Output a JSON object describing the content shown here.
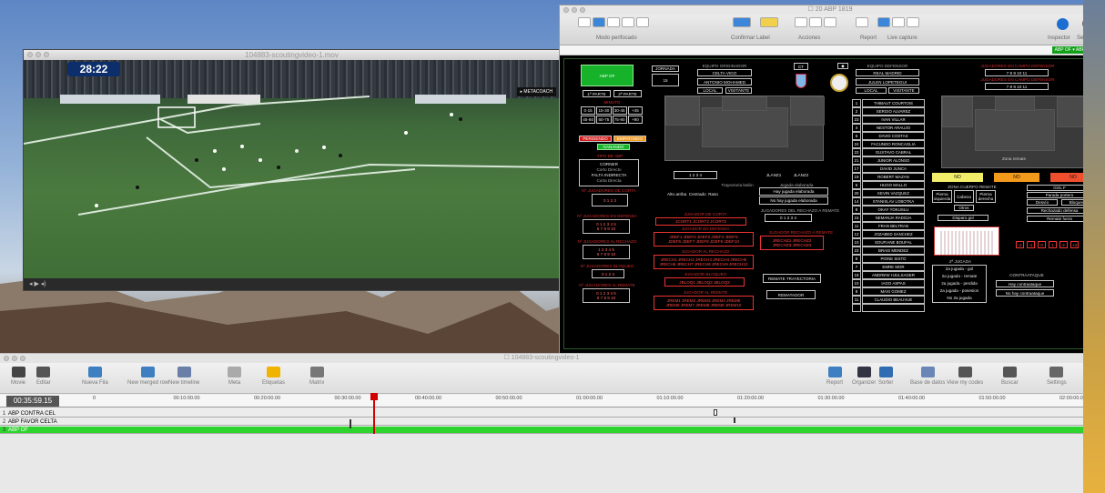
{
  "video": {
    "title": "104883-scoutingvideo-1.mov",
    "clock": "28:22",
    "brand": "▸ METACOACH",
    "control": "◂ ▶ ◂)"
  },
  "panel": {
    "title": "☐ 20 ABP 1819",
    "toolbar": {
      "modo": "Modo perifocado",
      "confirm": "Confirmar  Label",
      "acciones": "Acciones",
      "report": "Report",
      "live": "Live capture",
      "inspector": "Inspector",
      "settings": "Settings"
    },
    "tag": "ABP OF ▾ ABP OF ▴",
    "top_left": {
      "abp_of": "ABP OF",
      "jornada": "JORNADA",
      "jnum": "15",
      "equipo_label": "EQUIPO ORIGINADOR",
      "equipo": "CELTA VIGO",
      "jugador": "ANTONIO MOHAMED",
      "local": "LOCAL",
      "visitante": "VISITANTE",
      "parte1": "1ª PARTE",
      "parte2": "2ª PARTE",
      "minuto": "MINUTO",
      "min": [
        "0-15",
        "15-30",
        "30-45",
        "+45",
        "45-60",
        "60-75",
        "75-90",
        "+90"
      ],
      "ganando": "GANANDO",
      "empatando": "EMPATANDO",
      "perdiendo": "PERDIENDO"
    },
    "tipo": {
      "label": "TIPO DE ABP",
      "corner": "CORNER",
      "corto": "Corto",
      "directo": "Directo",
      "falta": "FALTA INDIRECTA",
      "corta": "Corta",
      "directa": "Directa"
    },
    "zona": {
      "label": "ZONA DE LANZAMIENTO",
      "nums": "1  2  3  4",
      "lanz1": "JLANZ1",
      "lanz2": "JLANZ2",
      "jugada": "Jugada elaborada",
      "hay": "Hay jugada elaborada",
      "no_hay": "No hay jugada elaborada"
    },
    "rechazo": {
      "label": "JUGADORES DEL RECHAZO A REMATE",
      "nums": "0  1  2  3  4"
    },
    "jug_defensa": {
      "label": "JUGADOR EN DEFENSA",
      "rows": [
        "JDEF1 JDEF2 JDEF3 JDEF4 JDEF5",
        "JDEF6 JDEF7 JDEF8 JDEF9 JDEF10"
      ]
    },
    "jug_corta": {
      "label": "JUGADOR DE CORTA",
      "rows": [
        "JCORT1 JCORT2 JCORT3"
      ]
    },
    "remate_rech": {
      "label": "JUGADOR RECHAZO A REMATE",
      "rows": [
        "JRECHZ1 JRECHZ2",
        "JRECHZ3 JRECHZ4"
      ]
    },
    "nums": {
      "corta_l": "Nº JUGADORES DE CORTA",
      "corta": "0 1 2 3",
      "def_l": "Nº JUGADORES EN DEFENSA",
      "def1": "0 1 2 3 4 5",
      "def2": "6 7 8 9 10",
      "rech_l": "Nº JUGADORES AL RECHAZO",
      "rech1": "1 2 3 4 5",
      "rech2": "6 7 8 9 10",
      "bloq_l": "Nº JUGADORES BLOQUEO",
      "bloq": "0 1 2 3",
      "remat_l": "Nº JUGADORES AL REMATE",
      "remat1": "0 1 2 3 4 5",
      "remat2": "6 7 8 9 10"
    },
    "rechaces": {
      "label": "JUGADOR AL RECHAZO",
      "rows": [
        "JRECH1 JRECH2 JRECH3 JRECH4 JRECH5",
        "JRECH6 JRECH7 JRECH8 JRECH9 JRECH10"
      ]
    },
    "bloqueo": {
      "label": "JUGADOR BLOQUEO",
      "row": "JBLOQ1 JBLOQ2 JBLOQ3"
    },
    "remate": {
      "label": "JUGADOR AL REMATE",
      "rows": [
        "JREM1 JREM2 JREM3 JREM4 JREM5",
        "JREM6 JREM7 JREM8 JREM9 JREM10"
      ]
    },
    "tray": "REMATE TRAYECTORIA",
    "remata": "REMATADOR",
    "rival": {
      "label": "EQUIPO DEFENSOR",
      "team": "REAL MADRID",
      "coach": "JULEN LOPETEGUI",
      "local": "LOCAL",
      "visitante": "VISITANTE"
    },
    "players": [
      [
        "1",
        "THIBAUT COURTOIS"
      ],
      [
        "2",
        "SERGIO ALVAREZ"
      ],
      [
        "23",
        "IVAN VILLAR"
      ],
      [
        "4",
        "NESTOR ARAUJO"
      ],
      [
        "5",
        "DAVID COSTAS"
      ],
      [
        "24",
        "FACUNDO RONCAGLIA"
      ],
      [
        "22",
        "GUSTAVO CABRAL"
      ],
      [
        "21",
        "JUNIOR ALONSO"
      ],
      [
        "17",
        "DAVID JUNCA"
      ],
      [
        "19",
        "ROBERT MAZAN"
      ],
      [
        "6",
        "HUGO MALLO"
      ],
      [
        "20",
        "KEVIN VAZQUEZ"
      ],
      [
        "14",
        "STANISLAV LOBOTKA"
      ],
      [
        "8",
        "OKAY YOKUSLU"
      ],
      [
        "15",
        "NEMANJA RADOJA"
      ],
      [
        "11",
        "FRAN BELTRAN"
      ],
      [
        "12",
        "JOZABED SANCHEZ"
      ],
      [
        "10",
        "SOUFIANE BOUFAL"
      ],
      [
        "23",
        "BRAIS MENDEZ"
      ],
      [
        "9",
        "PIONE SISTO"
      ],
      [
        "7",
        "EMRE MOR"
      ],
      [
        "18",
        "ANDREW HJULSAGER"
      ],
      [
        "10",
        "IAGO ASPAS"
      ],
      [
        "9",
        "MAXI GOMEZ"
      ],
      [
        "11",
        "CLAUDIO BEAUVUE"
      ],
      [
        "",
        ""
      ]
    ],
    "defensa": {
      "label": "JUGADORES EN CAMPO DEFENSOR",
      "row1": "7  8  9  10  11",
      "label2": "JUGADORES EN CAMPO DEFENSOR",
      "row2": "7  8  9  10  11"
    },
    "zona_remate": "Zona remate",
    "zona_cuerpo": "ZONA CUERPO REMATE",
    "cuerpo": {
      "izq": "Pierna izquierda",
      "cab": "Cabeza",
      "der": "Pierna derecha",
      "otro": "Otros"
    },
    "gol": "GOL F",
    "parada": "Parada portero",
    "desvio": "Desvío",
    "bloq": "Bloqueo",
    "rech_def": "Rechazado defensa",
    "fuera": "Remate fuera",
    "gol_sel": "Disparo gol",
    "opciones": [
      "NO",
      "NO",
      "NO"
    ],
    "jugadas": {
      "label": "2ª JUGADA",
      "g": "2a jugada - gol",
      "r": "2a jugada - remate",
      "p": "2a jugada - perdida",
      "pos": "2a jugada - posesion",
      "no": "No 2a jugada"
    },
    "contra": {
      "label": "CONTRAATAQUE",
      "hay": "Hay contraataque",
      "no": "No hay contraataque"
    },
    "red": [
      "-2",
      "-1",
      "0",
      "1",
      "2",
      "+3"
    ]
  },
  "timeline": {
    "title": "☐ 104883-scoutingvideo-1",
    "tools_left": [
      [
        "Movie",
        "#444"
      ],
      [
        "Editar",
        "#555"
      ],
      [
        "Nueva Fila",
        "#3d7fc1"
      ],
      [
        "New merged row",
        "#3d7fc1"
      ],
      [
        "New timeline",
        "#6a7fa8"
      ],
      [
        "Meta",
        "#aaa"
      ],
      [
        "Etiquetas",
        "#f0b400"
      ],
      [
        "Matrix",
        "#777"
      ]
    ],
    "tools_right": [
      [
        "Report",
        "#3d7fc1"
      ],
      [
        "Organizer",
        "#334"
      ],
      [
        "Sorter",
        "#2f6cb2"
      ],
      [
        "Base de datos",
        "#6a86b6"
      ],
      [
        "View my codes",
        "#555"
      ],
      [
        "Buscar",
        "#555"
      ],
      [
        "Settings",
        "#666"
      ]
    ],
    "timecode": "00:35:59.15",
    "ticks": [
      "0",
      "00:10:00.00",
      "00:20:00.00",
      "00:30:00.00",
      "00:40:00.00",
      "00:50:00.00",
      "01:00:00.00",
      "01:10:00.00",
      "01:20:00.00",
      "01:30:00.00",
      "01:40:00.00",
      "01:50:00.00",
      "02:00:00.00"
    ],
    "rows": [
      [
        "1",
        "ABP CONTRA CEL"
      ],
      [
        "2",
        "ABP FAVOR CELTA"
      ],
      [
        "3",
        "ABP OF"
      ]
    ]
  }
}
